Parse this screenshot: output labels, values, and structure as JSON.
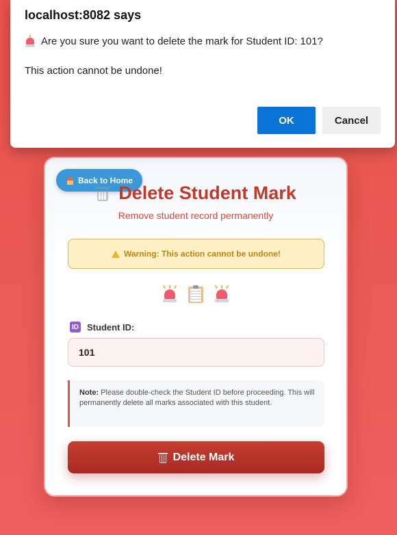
{
  "alert": {
    "title": "localhost:8082 says",
    "message_line1": "Are you sure you want to delete the mark for Student ID: 101?",
    "message_line2": "This action cannot be undone!",
    "ok_label": "OK",
    "cancel_label": "Cancel",
    "ok_color": "#0a74d6"
  },
  "card": {
    "home_label": "Back to Home",
    "title": "Delete Student Mark",
    "subtitle": "Remove student record permanently",
    "warning": "Warning: This action cannot be undone!",
    "icons": [
      "siren-icon",
      "clipboard-icon",
      "siren-icon"
    ],
    "field_label": "Student ID:",
    "field_value": "101",
    "note_label": "Note:",
    "note_text": "Please double-check the Student ID before proceeding. This will permanently delete all marks associated with this student.",
    "delete_label": "Delete Mark",
    "accent_color": "#c0392b"
  }
}
